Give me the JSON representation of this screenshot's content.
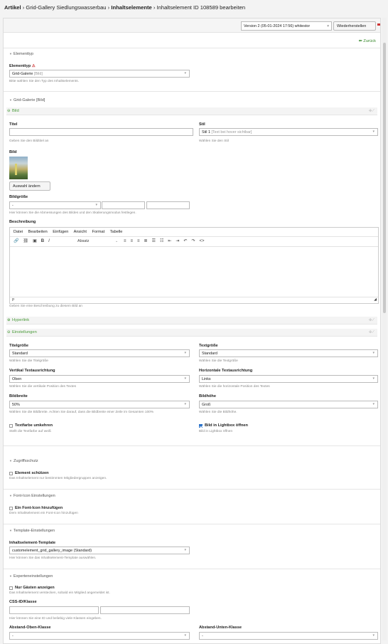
{
  "breadcrumb": {
    "item1": "Artikel",
    "sep": "›",
    "item2": "Grid-Gallery Siedlungswasserbau",
    "item3": "Inhaltselemente",
    "item4": "Inhaltselement ID 108589 bearbeiten"
  },
  "topbar": {
    "version_value": "Version 2 (05-01-2024 17:56) whitestor",
    "restore_label": "Wiederherstellen"
  },
  "back_label": "Zurück",
  "sections": {
    "elementtyp": "Elementtyp",
    "grid_galerie": "Grid-Galerie [Bild]",
    "zugriffsschutz": "Zugriffsschutz",
    "font_icon": "Font-Icon Einstellungen",
    "template": "Template-Einstellungen",
    "experten": "Experteneinstellungen"
  },
  "elementtyp": {
    "label": "Elementtyp",
    "value": "Grid-Galerie",
    "value_suffix": "[Bild]",
    "hint": "Bitte wählen Sie den Typ des Inhaltselements."
  },
  "panels": {
    "bild": "Bild",
    "hyperlink": "Hyperlink",
    "einstellungen": "Einstellungen"
  },
  "bild": {
    "titel_label": "Titel",
    "titel_hint": "Geben Sie den Bildtitel an",
    "stil_label": "Stil",
    "stil_value": "Stil 1",
    "stil_suffix": "[Text bei hover sichtbar]",
    "stil_hint": "Wählen Sie den Stil",
    "bild_label": "Bild",
    "change_button": "Auswahl ändern",
    "groesse_label": "Bildgröße",
    "groesse_value": "-",
    "groesse_hint": "Hier können Sie die Abmessungen des Bildes und den Skalierungsmodus festlegen.",
    "beschreibung_label": "Beschreibung",
    "beschreibung_hint": "Geben Sie eine Beschreibung zu diesem Bild an"
  },
  "editor": {
    "menu": [
      "Datei",
      "Bearbeiten",
      "Einfügen",
      "Ansicht",
      "Format",
      "Tabelle"
    ],
    "absatz": "Absatz",
    "status_path": "P"
  },
  "settings": {
    "titelgroesse_label": "Titelgröße",
    "titelgroesse_value": "Standard",
    "titelgroesse_hint": "Wählen Sie die Titelgröße",
    "textgroesse_label": "Textgröße",
    "textgroesse_value": "Standard",
    "textgroesse_hint": "Wählen Sie die Textgröße",
    "vertikal_label": "Vertikal Textausrichtung",
    "vertikal_value": "Oben",
    "vertikal_hint": "Wählen Sie die vertikale Position des Textes",
    "horizontal_label": "Horizontale Textausrichtung",
    "horizontal_value": "Links",
    "horizontal_hint": "Wählen Sie die horizontale Position des Textes",
    "bildbreite_label": "Bildbreite",
    "bildbreite_value": "50%",
    "bildbreite_hint": "Wählen Sie die Bildbreite. Achten Sie darauf, dass die Bildbreite einer Zeile im Gesamten 100%",
    "bildhoehe_label": "Bildhöhe",
    "bildhoehe_value": "Groß",
    "bildhoehe_hint": "Wählen Sie die Bildhöhe.",
    "textfarbe_label": "Textfarbe umkehren",
    "textfarbe_hint": "Stellt die Textfarbe auf weiß",
    "textfarbe_checked": false,
    "lightbox_label": "Bild in Lightbox öffnen",
    "lightbox_hint": "Bild in Lightbox öffnen",
    "lightbox_checked": true
  },
  "zugriff": {
    "label": "Element schützen",
    "hint": "Das Inhaltselement nur bestimmten Mitgliedergruppen anzeigen."
  },
  "fonticon": {
    "label": "Ein Font-Icon hinzufügen",
    "hint": "Dem Inhaltselement ein Font-Icon hinzufügen"
  },
  "template": {
    "label": "Inhaltselement-Template",
    "value": "customelement_grid_gallery_image (Standard)",
    "hint": "Hier können Sie das Inhaltselement-Template auswählen."
  },
  "experten": {
    "gaeste_label": "Nur Gästen anzeigen",
    "gaeste_hint": "Das Inhaltselement verstecken, sobald ein Mitglied angemeldet ist.",
    "css_label": "CSS-ID/Klasse",
    "css_hint": "Hier können Sie eine ID und beliebig viele Klassen eingeben.",
    "abstand_oben_label": "Abstand-Oben-Klasse",
    "abstand_oben_value": "-",
    "abstand_unten_label": "Abstand-Unten-Klasse",
    "abstand_unten_value": "-"
  },
  "colors": {
    "accent_green": "#4a9b3a",
    "checkbox_blue": "#2a72c9",
    "warning_red": "#c33"
  }
}
